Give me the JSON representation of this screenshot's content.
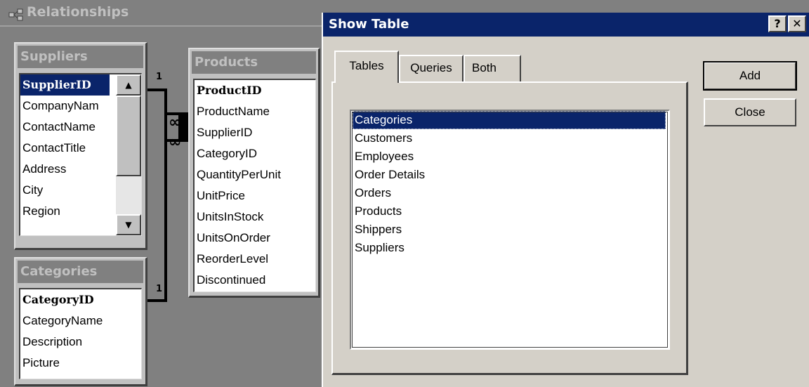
{
  "relationships_window": {
    "title": "Relationships",
    "tables": {
      "suppliers": {
        "title": "Suppliers",
        "fields": [
          "SupplierID",
          "CompanyNam",
          "ContactName",
          "ContactTitle",
          "Address",
          "City",
          "Region"
        ],
        "selected_field": "SupplierID"
      },
      "products": {
        "title": "Products",
        "fields": [
          "ProductID",
          "ProductName",
          "SupplierID",
          "CategoryID",
          "QuantityPerUnit",
          "UnitPrice",
          "UnitsInStock",
          "UnitsOnOrder",
          "ReorderLevel",
          "Discontinued"
        ]
      },
      "categories": {
        "title": "Categories",
        "fields": [
          "CategoryID",
          "CategoryName",
          "Description",
          "Picture"
        ]
      }
    },
    "join_labels": {
      "one_side_suppliers": "1",
      "one_side_categories": "1",
      "many_side_1": "∞",
      "many_side_2": "∞"
    }
  },
  "show_table_dialog": {
    "title": "Show Table",
    "help_button": "?",
    "close_button": "✕",
    "tabs": [
      "Tables",
      "Queries",
      "Both"
    ],
    "active_tab": "Tables",
    "table_list": [
      "Categories",
      "Customers",
      "Employees",
      "Order Details",
      "Orders",
      "Products",
      "Shippers",
      "Suppliers"
    ],
    "selected_item": "Categories",
    "buttons": {
      "add": "Add",
      "close": "Close"
    }
  }
}
